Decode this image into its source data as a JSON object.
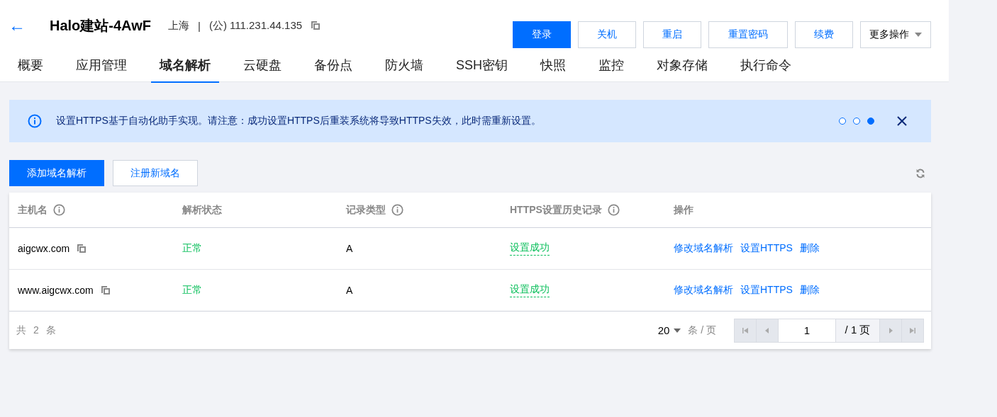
{
  "header": {
    "back": "←",
    "title": "Halo建站-4AwF",
    "region": "上海",
    "separator": "|",
    "ip": "(公) 111.231.44.135"
  },
  "actions": [
    {
      "label": "登录",
      "kind": "primary"
    },
    {
      "label": "关机",
      "kind": "link"
    },
    {
      "label": "重启",
      "kind": "link"
    },
    {
      "label": "重置密码",
      "kind": "link"
    },
    {
      "label": "续费",
      "kind": "link"
    },
    {
      "label": "更多操作",
      "kind": "dropdown"
    }
  ],
  "tabs": [
    {
      "label": "概要",
      "selected": false
    },
    {
      "label": "应用管理",
      "selected": false
    },
    {
      "label": "域名解析",
      "selected": true
    },
    {
      "label": "云硬盘",
      "selected": false
    },
    {
      "label": "备份点",
      "selected": false
    },
    {
      "label": "防火墙",
      "selected": false
    },
    {
      "label": "SSH密钥",
      "selected": false
    },
    {
      "label": "快照",
      "selected": false
    },
    {
      "label": "监控",
      "selected": false
    },
    {
      "label": "对象存储",
      "selected": false
    },
    {
      "label": "执行命令",
      "selected": false
    }
  ],
  "notice": {
    "text": "设置HTTPS基于自动化助手实现。请注意：成功设置HTTPS后重装系统将导致HTTPS失效，此时需重新设置。",
    "dots": [
      {
        "selected": false
      },
      {
        "selected": false
      },
      {
        "selected": true
      }
    ]
  },
  "toolbar": [
    {
      "label": "添加域名解析",
      "kind": "primary"
    },
    {
      "label": "注册新域名",
      "kind": "link"
    }
  ],
  "table": {
    "columns": [
      {
        "label": "主机名",
        "info": true
      },
      {
        "label": "解析状态",
        "info": false
      },
      {
        "label": "记录类型",
        "info": true
      },
      {
        "label": "HTTPS设置历史记录",
        "info": true
      },
      {
        "label": "操作",
        "info": false
      }
    ],
    "rows": [
      {
        "host": "aigcwx.com",
        "status": "正常",
        "type": "A",
        "https": "设置成功",
        "ops": [
          "修改域名解析",
          "设置HTTPS",
          "删除"
        ]
      },
      {
        "host": "www.aigcwx.com",
        "status": "正常",
        "type": "A",
        "https": "设置成功",
        "ops": [
          "修改域名解析",
          "设置HTTPS",
          "删除"
        ]
      }
    ]
  },
  "pagination": {
    "total": "共 2 条",
    "page_size": "20",
    "page_size_unit": "条 / 页",
    "page": "1",
    "pages": "/ 1 页"
  }
}
